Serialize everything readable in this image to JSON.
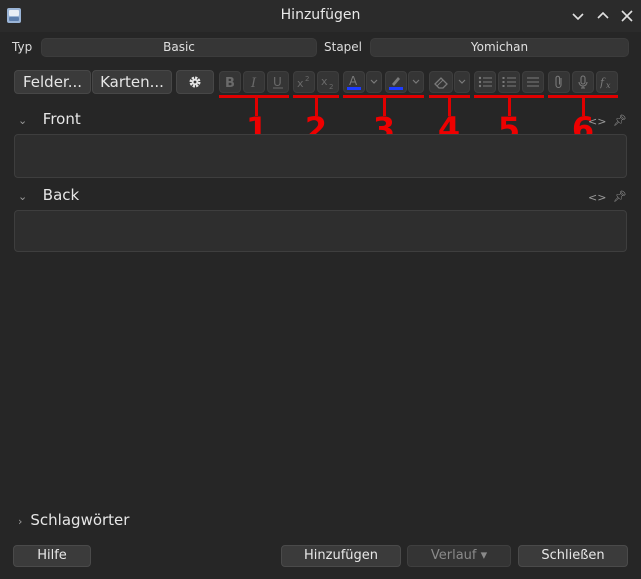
{
  "window": {
    "title": "Hinzufügen"
  },
  "header": {
    "type_label": "Typ",
    "type_value": "Basic",
    "deck_label": "Stapel",
    "deck_value": "Yomichan"
  },
  "toolbar": {
    "fields_button": "Felder...",
    "cards_button": "Karten..."
  },
  "annotations": [
    "1",
    "2",
    "3",
    "4",
    "5",
    "6"
  ],
  "fields": [
    {
      "name": "Front",
      "value": ""
    },
    {
      "name": "Back",
      "value": ""
    }
  ],
  "tags": {
    "label": "Schlagwörter"
  },
  "footer": {
    "help": "Hilfe",
    "add": "Hinzufügen",
    "history": "Verlauf ▾",
    "close": "Schließen"
  },
  "colors": {
    "annotation": "#e00000",
    "text_color_underline": "#1e3cff",
    "highlight_underline": "#1e3cff"
  }
}
